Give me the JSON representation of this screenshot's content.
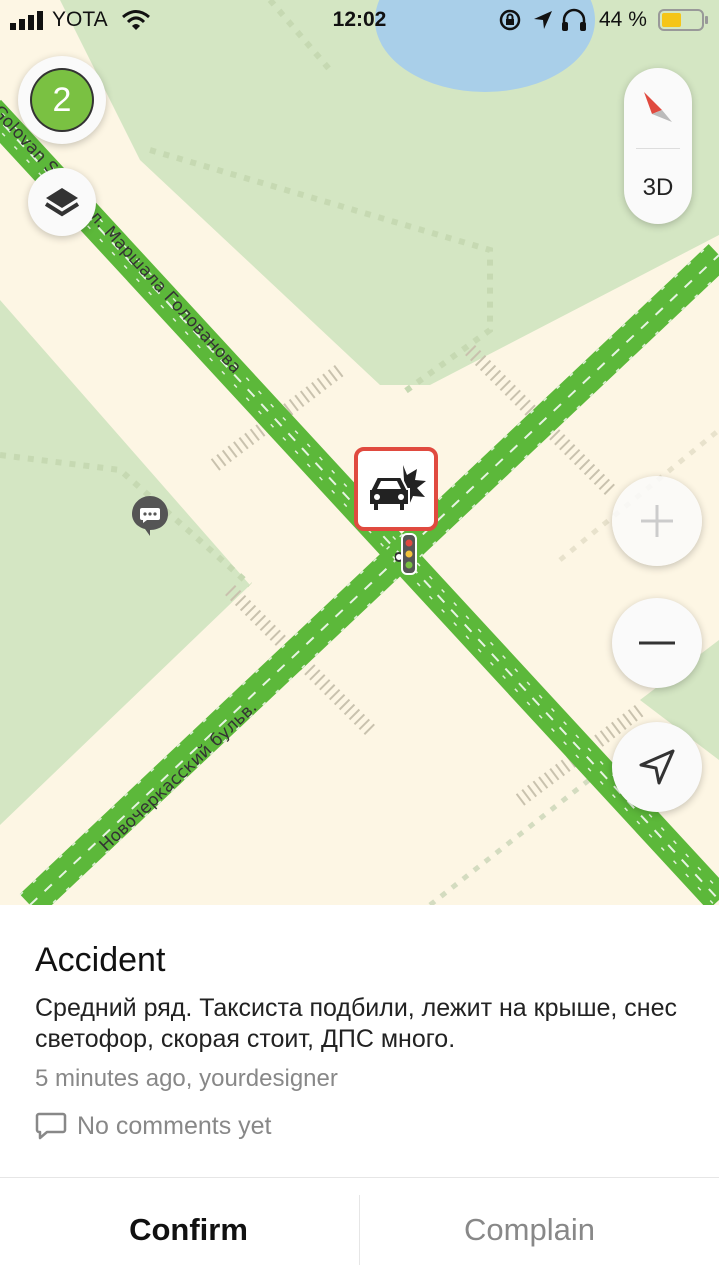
{
  "status_bar": {
    "carrier": "YOTA",
    "time": "12:02",
    "battery_percent": "44 %"
  },
  "map": {
    "layers_badge_count": "2",
    "compass_3d_label": "3D",
    "street_labels": [
      "Golovan Street ул. Маршала Голованова",
      "Новочеркасский бульв."
    ],
    "incident_type_icon": "car-crash-icon",
    "colors": {
      "road_fill": "#fdf6e4",
      "park_fill": "#d4e6c3",
      "traffic_green": "#5cb83a",
      "water": "#a9cfe9",
      "incident_border": "#e04a3f"
    }
  },
  "incident": {
    "title": "Accident",
    "description": "Средний ряд. Таксиста подбили, лежит на крыше, снес светофор, скорая стоит, ДПС много.",
    "meta": "5 minutes ago, yourdesigner",
    "comments_label": "No comments yet"
  },
  "actions": {
    "confirm_label": "Confirm",
    "complain_label": "Complain"
  }
}
